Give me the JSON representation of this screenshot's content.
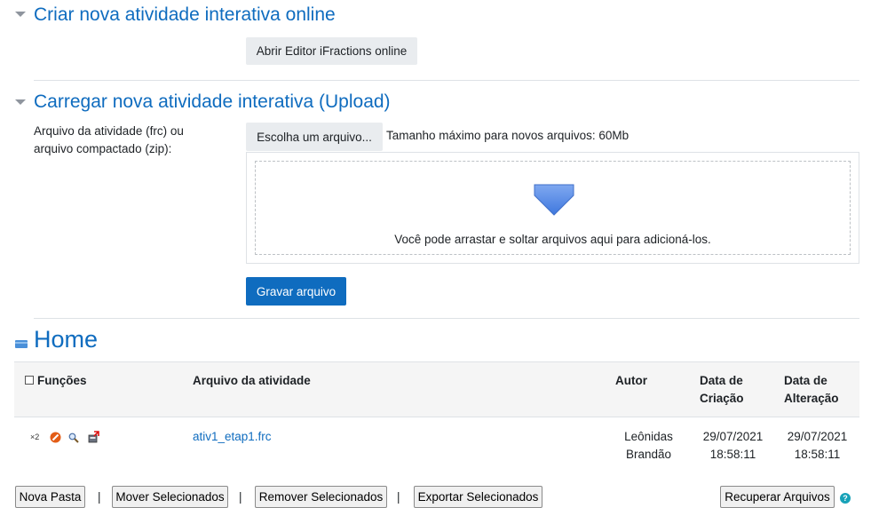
{
  "create_section": {
    "title": "Criar nova atividade interativa online",
    "open_editor_label": "Abrir Editor iFractions online"
  },
  "upload_section": {
    "title": "Carregar nova atividade interativa (Upload)",
    "field_label": "Arquivo da atividade (frc) ou arquivo compactado (zip):",
    "choose_file_label": "Escolha um arquivo...",
    "max_size_text": "Tamanho máximo para novos arquivos: 60Mb",
    "drop_hint": "Você pode arrastar e soltar arquivos aqui para adicioná-los.",
    "save_label": "Gravar arquivo"
  },
  "home": {
    "title": "Home",
    "table": {
      "headers": {
        "functions": "Funções",
        "file": "Arquivo da atividade",
        "author": "Autor",
        "created": "Data de Criação",
        "modified": "Data de Alteração"
      },
      "rows": [
        {
          "duplicate_marker": "×2",
          "file": "ativ1_etap1.frc",
          "author": "Leônidas Brandão",
          "created_date": "29/07/2021",
          "created_time": "18:58:11",
          "modified_date": "29/07/2021",
          "modified_time": "18:58:11"
        }
      ]
    },
    "actions": {
      "new_folder": "Nova Pasta",
      "move_selected": "Mover Selecionados",
      "remove_selected": "Remover Selecionados",
      "export_selected": "Exportar Selecionados",
      "separator": "|",
      "recover_files": "Recuperar Arquivos",
      "help_glyph": "?"
    }
  },
  "colors": {
    "primary": "#0f6cbf",
    "link": "#0f6cbf",
    "secondary_button": "#e9ecef",
    "table_header_bg": "#f5f5f5",
    "arrow_blue": "#5a8ee8"
  },
  "icons": [
    "caret-down-icon",
    "folder-icon",
    "checkbox-icon",
    "duplicate-icon",
    "delete-icon",
    "preview-icon",
    "export-icon",
    "download-arrow-icon",
    "help-icon"
  ]
}
